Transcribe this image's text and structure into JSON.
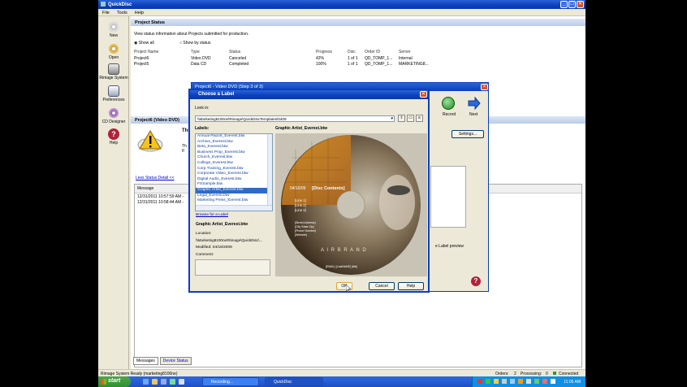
{
  "window": {
    "title": "QuickDisc"
  },
  "menu": [
    "File",
    "Tools",
    "Help"
  ],
  "sidebar": [
    {
      "label": "New",
      "icon": "new-disc-icon"
    },
    {
      "label": "Open",
      "icon": "open-disc-icon"
    },
    {
      "label": "Rimage System",
      "icon": "rimage-system-icon"
    },
    {
      "label": "Preferences",
      "icon": "preferences-icon"
    },
    {
      "label": "CD Designer",
      "icon": "cd-designer-icon"
    },
    {
      "label": "Help",
      "icon": "help-icon"
    }
  ],
  "project_status": {
    "title": "Project Status",
    "description": "View status information about Projects submitted for production.",
    "radio_all": "Show all",
    "radio_by_status": "Show by status",
    "columns": [
      "Project Name",
      "Type",
      "Status",
      "Progress",
      "Disc",
      "Order ID",
      "Server"
    ],
    "rows": [
      [
        "Project6",
        "Video DVD",
        "Canceled",
        "42%",
        "1 of 1",
        "QD_TOMP_1...",
        "Internal"
      ],
      [
        "Project5",
        "Data CD",
        "Completed",
        "100%",
        "1 of 1",
        "QD_TOMP_1...",
        "MARKETING8..."
      ]
    ]
  },
  "project_detail": {
    "title": "Project6 (Video DVD)",
    "heading_fragment": "Thi",
    "line1": "Th",
    "line2": "If",
    "less_status_link": "Less Status Detail <<",
    "msg_header": "Message",
    "messages": [
      "12/31/2011 10:57:59 AM -",
      "12/31/2011 10:58:44 AM -"
    ],
    "record_label": "Record",
    "next_label": "Next",
    "settings_label": "Settings...",
    "preview_note": "e Label preview",
    "tabs": [
      "Messages",
      "Device Status"
    ]
  },
  "back_dialog": {
    "title": "Project6 - Video DVD (Step 3 of 3)"
  },
  "dialog": {
    "title": "Choose a Label",
    "look_in_label": "Look in:",
    "look_in_path": "\\\\Marketing8100ne\\Rimage\\QuickDiscTemplates\\0409",
    "labels_title": "Labels:",
    "labels": [
      "Annual Report_Everest.btw",
      "Archive_Everest.btw",
      "Beta_Everest.btw",
      "Business Prop_Everest.btw",
      "Church_Everest.btw",
      "College_Everest.btw",
      "Corp Training_Everest.btw",
      "Corporate Video_Everest.btw",
      "Digital Audio_Everest.btw",
      "FSSample.btw",
      "Graphic Artist_Everest.btw",
      "Legal_Everest.btw",
      "Marketing Press_Everest.btw"
    ],
    "selected_index": 10,
    "browse_link": "Browse for a Label",
    "file_name": "Graphic Artist_Everest.btw",
    "location_label": "Location:",
    "location_value": "\\\\Marketing8100ne\\Rimage\\QuickDisc\\...",
    "modified": "Modified: 04/16/2009",
    "comment_label": "Comment:",
    "preview_title": "Graphic Artist_Everest.btw",
    "disc": {
      "date": "04/16/09",
      "contents": "[Disc Contents]",
      "lines": [
        "[Line 1]",
        "[Line 2]",
        "[Line 3]"
      ],
      "address": [
        "[Street Address]",
        "[City State Zip]",
        "[Phone Number]",
        "[Website]"
      ],
      "email": "[EMAIL] [LastNAME] [title]",
      "brand": "A I R B R A N D"
    },
    "ok": "OK",
    "cancel": "Cancel",
    "help": "Help"
  },
  "status_bar": {
    "left": "Rimage System Ready (marketing8100ne)",
    "orders": "Orders:",
    "orders_val": "2",
    "processing": "Processing:",
    "processing_val": "0",
    "connected": "Connected"
  },
  "taskbar": {
    "start": "start",
    "apps": [
      "Recording...",
      "QuickDisc"
    ],
    "clock": "11:05 AM"
  },
  "colors": {
    "xp_blue": "#0a3fbd",
    "panel": "#ece9d8",
    "selection": "#316ac5",
    "start_green": "#2f8f2f"
  }
}
